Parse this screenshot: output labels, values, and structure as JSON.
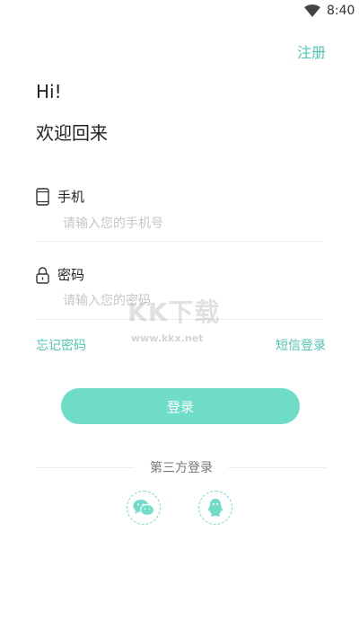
{
  "status": {
    "time": "8:40"
  },
  "header": {
    "register_label": "注册"
  },
  "greeting": {
    "hi": "Hi!",
    "welcome": "欢迎回来"
  },
  "form": {
    "phone": {
      "label": "手机",
      "placeholder": "请输入您的手机号",
      "value": ""
    },
    "password": {
      "label": "密码",
      "placeholder": "请输入您的密码",
      "value": ""
    },
    "forgot_label": "忘记密码",
    "sms_label": "短信登录",
    "login_label": "登录"
  },
  "third_party": {
    "title": "第三方登录"
  },
  "watermark": {
    "title": "KK下载",
    "url": "www.kkx.net"
  },
  "colors": {
    "accent": "#4fc7b2",
    "button": "#6fdcc7"
  }
}
